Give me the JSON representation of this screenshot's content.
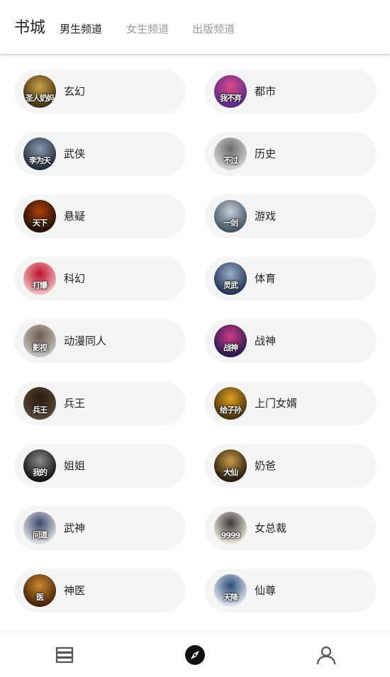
{
  "header": {
    "title": "书城",
    "tabs": [
      {
        "label": "男生频道",
        "active": true
      },
      {
        "label": "女生频道",
        "active": false
      },
      {
        "label": "出版频道",
        "active": false
      }
    ]
  },
  "categories": [
    {
      "label": "玄幻",
      "cover_text": "圣人奶妈",
      "colors": [
        "#3a2a10",
        "#caa24a"
      ]
    },
    {
      "label": "都市",
      "cover_text": "我不弃",
      "colors": [
        "#4a2a8a",
        "#e04a8a"
      ]
    },
    {
      "label": "武侠",
      "cover_text": "李为天",
      "colors": [
        "#1c2433",
        "#8a9ab0"
      ]
    },
    {
      "label": "历史",
      "cover_text": "不过",
      "colors": [
        "#d8d8d8",
        "#6a6a6a"
      ]
    },
    {
      "label": "悬疑",
      "cover_text": "天下",
      "colors": [
        "#120c08",
        "#b0400a"
      ]
    },
    {
      "label": "游戏",
      "cover_text": "一剑",
      "colors": [
        "#3a4a5a",
        "#c8d0d8"
      ]
    },
    {
      "label": "科幻",
      "cover_text": "打爆",
      "colors": [
        "#f0c8c8",
        "#c0102a"
      ]
    },
    {
      "label": "体育",
      "cover_text": "灵武",
      "colors": [
        "#1a2a4a",
        "#9ab0cc"
      ]
    },
    {
      "label": "动漫同人",
      "cover_text": "影视",
      "colors": [
        "#c8c8c8",
        "#6a5a4a"
      ]
    },
    {
      "label": "战神",
      "cover_text": "战神",
      "colors": [
        "#1a1a4a",
        "#d03a8a"
      ]
    },
    {
      "label": "兵王",
      "cover_text": "兵王",
      "colors": [
        "#5a4a3a",
        "#2a1a10"
      ]
    },
    {
      "label": "上门女婿",
      "cover_text": "给子孙",
      "colors": [
        "#3a2a10",
        "#e0a020"
      ]
    },
    {
      "label": "姐姐",
      "cover_text": "我的",
      "colors": [
        "#0a0a0a",
        "#8a8a8a"
      ]
    },
    {
      "label": "奶爸",
      "cover_text": "大仙",
      "colors": [
        "#1a120a",
        "#c89a4a"
      ]
    },
    {
      "label": "武神",
      "cover_text": "问道",
      "colors": [
        "#e8e8e8",
        "#3a4a6a"
      ]
    },
    {
      "label": "女总裁",
      "cover_text": "9999",
      "colors": [
        "#f4f0e0",
        "#3a3a3a"
      ]
    },
    {
      "label": "神医",
      "cover_text": "医",
      "colors": [
        "#3a1a08",
        "#d08a30"
      ]
    },
    {
      "label": "仙尊",
      "cover_text": "天降",
      "colors": [
        "#e8eef4",
        "#2a4a7a"
      ]
    }
  ],
  "bottom_nav": [
    {
      "name": "bookshelf",
      "icon": "stack-icon"
    },
    {
      "name": "discover",
      "icon": "compass-icon",
      "active": true
    },
    {
      "name": "profile",
      "icon": "user-icon"
    }
  ]
}
